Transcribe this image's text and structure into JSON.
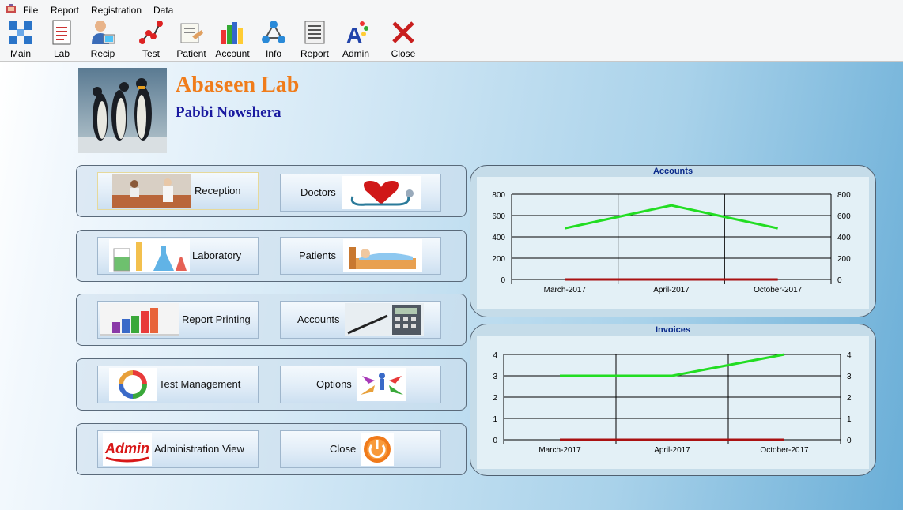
{
  "menu": {
    "items": [
      "File",
      "Report",
      "Registration",
      "Data"
    ]
  },
  "toolbar": {
    "buttons": [
      {
        "label": "Main",
        "icon": "main-icon"
      },
      {
        "label": "Lab",
        "icon": "lab-icon"
      },
      {
        "label": "Recip",
        "icon": "reception-icon"
      },
      {
        "label": "Test",
        "icon": "test-icon"
      },
      {
        "label": "Patient",
        "icon": "patient-icon"
      },
      {
        "label": "Account",
        "icon": "account-icon"
      },
      {
        "label": "Info",
        "icon": "info-icon"
      },
      {
        "label": "Report",
        "icon": "report-icon"
      },
      {
        "label": "Admin",
        "icon": "admin-icon"
      },
      {
        "label": "Close",
        "icon": "close-icon"
      }
    ]
  },
  "header": {
    "lab_name": "Abaseen Lab",
    "city": "Pabbi Nowshera"
  },
  "buttons": {
    "reception": "Reception",
    "doctors": "Doctors",
    "laboratory": "Laboratory",
    "patients": "Patients",
    "report_printing": "Report Printing",
    "accounts": "Accounts",
    "test_management": "Test Management",
    "options": "Options",
    "administration_view": "Administration View",
    "close": "Close",
    "admin_logo_text": "Admin"
  },
  "chart_data": [
    {
      "type": "line",
      "title": "Accounts",
      "categories": [
        "March-2017",
        "April-2017",
        "October-2017"
      ],
      "series": [
        {
          "color": "#22dd22",
          "values": [
            480,
            695,
            480
          ]
        },
        {
          "color": "#aa1111",
          "values": [
            0,
            0,
            0
          ]
        }
      ],
      "ylim": [
        0,
        800
      ],
      "yticks": [
        0,
        200,
        400,
        600,
        800
      ],
      "grid": true,
      "secondary_axis": true
    },
    {
      "type": "line",
      "title": "Invoices",
      "categories": [
        "March-2017",
        "April-2017",
        "October-2017"
      ],
      "series": [
        {
          "color": "#22dd22",
          "values": [
            3,
            3,
            4
          ]
        },
        {
          "color": "#aa1111",
          "values": [
            0,
            0,
            0
          ]
        }
      ],
      "ylim": [
        0,
        4
      ],
      "yticks": [
        0,
        1,
        2,
        3,
        4
      ],
      "grid": true,
      "secondary_axis": true
    }
  ]
}
